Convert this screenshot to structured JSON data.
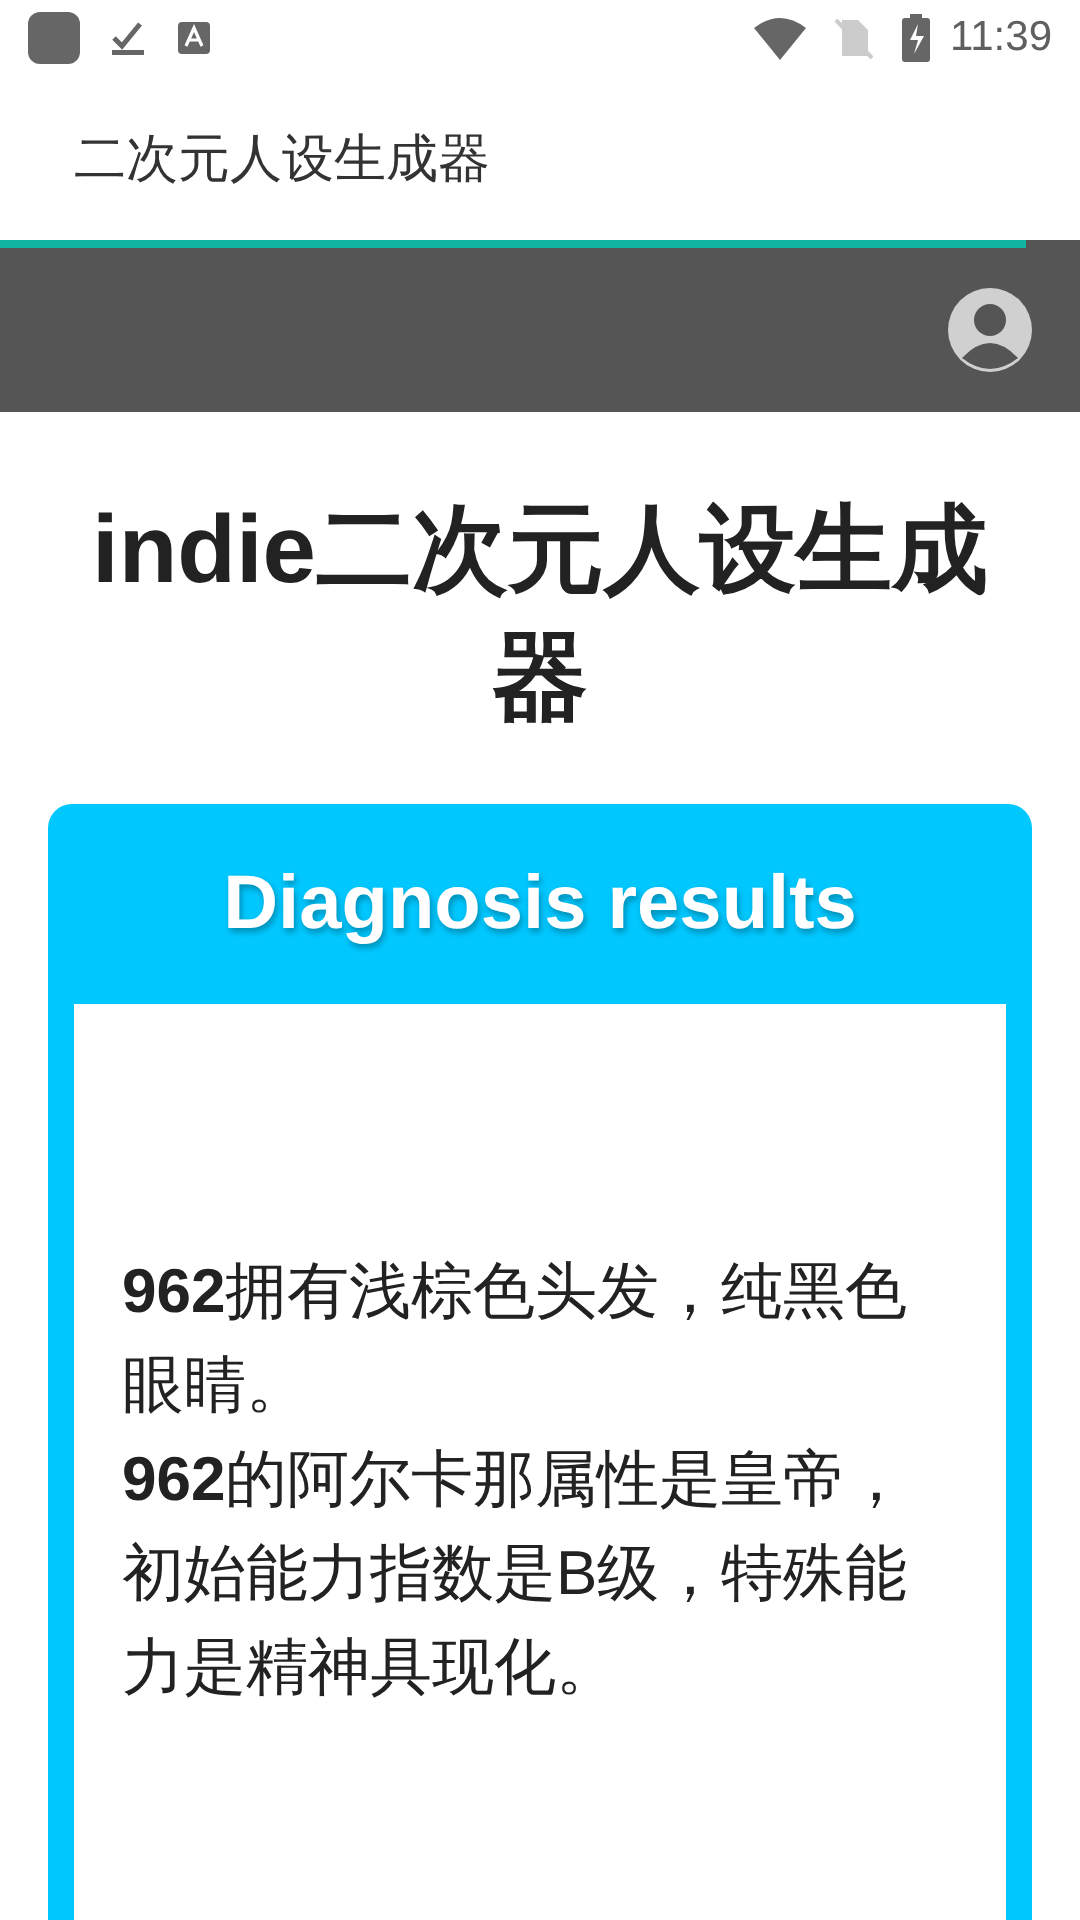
{
  "status_bar": {
    "time": "11:39"
  },
  "app_bar": {
    "title": "二次元人设生成器"
  },
  "loading_bar": {
    "level": 0.95
  },
  "heading": "indie二次元人设生成器",
  "result_card": {
    "title": "Diagnosis results",
    "paragraphs": [
      "**962**拥有浅棕色头发，纯黑色眼睛。",
      "**962**的阿尔卡那属性是皇帝，初始能力指数是B级，特殊能力是精神具现化。"
    ]
  }
}
